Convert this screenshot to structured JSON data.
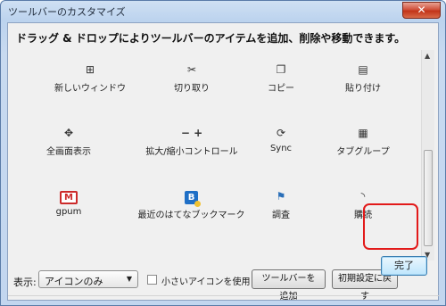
{
  "window": {
    "title": "ツールバーのカスタマイズ",
    "close_glyph": "✕"
  },
  "instruction": "ドラッグ & ドロップによりツールバーのアイテムを追加、削除や移動できます。",
  "palette": {
    "rows": [
      {
        "items": [
          {
            "label": "新しいウィンドウ",
            "icon": "new-window-icon",
            "glyph": "⊞"
          },
          {
            "label": "切り取り",
            "icon": "scissors-icon",
            "glyph": "✂"
          },
          {
            "label": "コピー",
            "icon": "copy-icon",
            "glyph": "❐"
          },
          {
            "label": "貼り付け",
            "icon": "clipboard-icon",
            "glyph": "▤"
          }
        ]
      },
      {
        "items": [
          {
            "label": "全画面表示",
            "icon": "fullscreen-icon",
            "glyph": "✥"
          },
          {
            "label": "拡大/縮小コントロール",
            "icon": "zoom-icon",
            "glyph": "−  +"
          },
          {
            "label": "Sync",
            "icon": "sync-icon",
            "glyph": "⟳"
          },
          {
            "label": "タブグループ",
            "icon": "tab-groups-icon",
            "glyph": "▦"
          }
        ]
      },
      {
        "items": [
          {
            "label": "gpum",
            "icon": "gmail-icon",
            "glyph": "M"
          },
          {
            "label": "最近のはてなブックマーク",
            "icon": "hatena-bookmark-icon",
            "glyph": "B"
          },
          {
            "label": "調査",
            "icon": "research-icon",
            "glyph": "⚑"
          },
          {
            "label": "購読",
            "icon": "feed-icon",
            "glyph": "◝"
          }
        ]
      }
    ],
    "highlight_color": "#e21a1a"
  },
  "scrollbar": {
    "up_glyph": "▲",
    "down_glyph": "▼"
  },
  "options": {
    "show_label": "表示:",
    "show_value": "アイコンのみ",
    "dropdown_glyph": "▼",
    "small_icons_label": "小さいアイコンを使用",
    "small_icons_checked": false,
    "add_toolbar_label": "ツールバーを追加",
    "reset_label": "初期設定に戻す"
  },
  "done_label": "完了",
  "colors": {
    "frame": "#c2d6ef",
    "close_button": "#c23418",
    "done_button": "#bee6fd"
  }
}
